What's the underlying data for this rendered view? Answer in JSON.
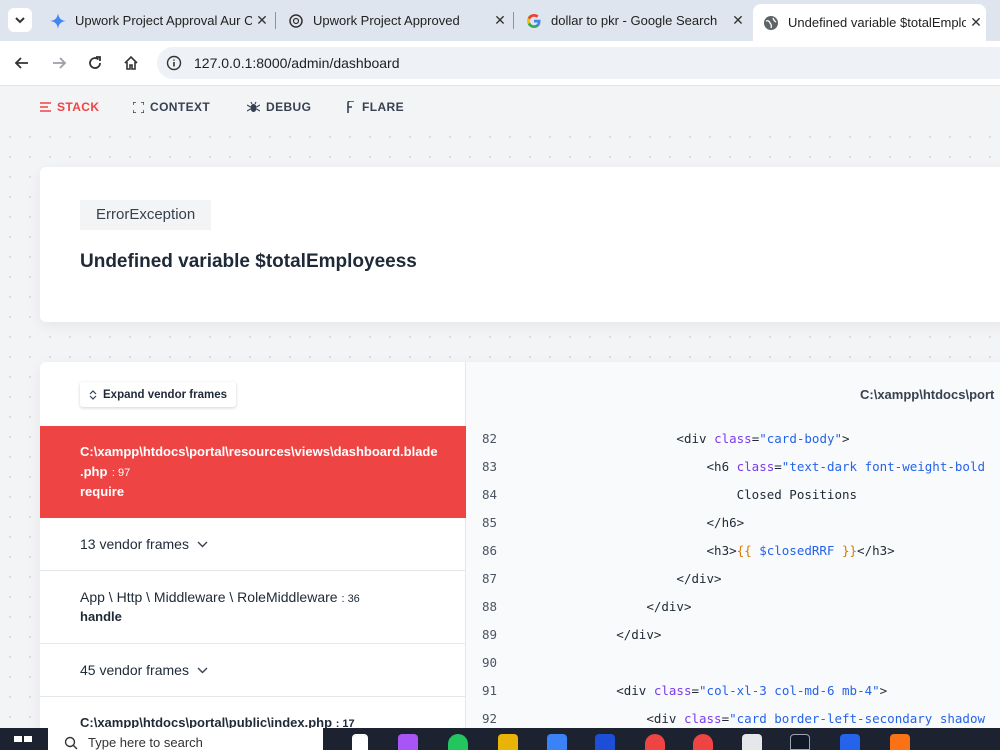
{
  "browser": {
    "tabs": [
      {
        "title": "Upwork Project Approval Aur C",
        "favicon": "gemini-sparkle-icon",
        "active": false
      },
      {
        "title": "Upwork Project Approved",
        "favicon": "chatgpt-icon",
        "active": false
      },
      {
        "title": "dollar to pkr - Google Search",
        "favicon": "google-icon",
        "active": false
      },
      {
        "title": "Undefined variable $totalEmplo",
        "favicon": "globe-icon",
        "active": true
      }
    ],
    "url": "127.0.0.1:8000/admin/dashboard"
  },
  "ignition_nav": {
    "items": [
      {
        "label": "STACK",
        "icon": "stack-icon"
      },
      {
        "label": "CONTEXT",
        "icon": "context-icon"
      },
      {
        "label": "DEBUG",
        "icon": "bug-icon"
      },
      {
        "label": "FLARE",
        "icon": "flare-icon"
      }
    ]
  },
  "error": {
    "exception": "ErrorException",
    "message": "Undefined variable $totalEmployeess"
  },
  "stack": {
    "expand_label": "Expand vendor frames",
    "active_frame": {
      "path": "C:\\xampp\\htdocs\\portal\\resources\\views\\dashboard.blade",
      "path_end": ".php",
      "line": ": 97",
      "method": "require"
    },
    "vendor_frames_1": "13 vendor frames",
    "frame2": {
      "path": "App \\ Http \\ Middleware \\ RoleMiddleware",
      "line": ": 36",
      "method": "handle"
    },
    "vendor_frames_2": "45 vendor frames",
    "frame3": {
      "path": "C:\\xampp\\htdocs\\portal\\public\\index.php",
      "line": ": 17"
    }
  },
  "code": {
    "file_path": "C:\\xampp\\htdocs\\port",
    "lines": [
      {
        "n": "82",
        "indent": "                ",
        "parts": [
          [
            "tg",
            "<div "
          ],
          [
            "at",
            "class"
          ],
          [
            "tg",
            "="
          ],
          [
            "st",
            "\"card-body\""
          ],
          [
            "tg",
            ">"
          ]
        ]
      },
      {
        "n": "83",
        "indent": "                    ",
        "parts": [
          [
            "tg",
            "<h6 "
          ],
          [
            "at",
            "class"
          ],
          [
            "tg",
            "="
          ],
          [
            "st",
            "\"text-dark font-weight-bold"
          ]
        ]
      },
      {
        "n": "84",
        "indent": "                        ",
        "parts": [
          [
            "tg",
            "Closed Positions"
          ]
        ]
      },
      {
        "n": "85",
        "indent": "                    ",
        "parts": [
          [
            "tg",
            "</h6>"
          ]
        ]
      },
      {
        "n": "86",
        "indent": "                    ",
        "parts": [
          [
            "tg",
            "<h3>"
          ],
          [
            "bl",
            "{{ "
          ],
          [
            "vr",
            "$closedRRF"
          ],
          [
            "bl",
            " }}"
          ],
          [
            "tg",
            "</h3>"
          ]
        ]
      },
      {
        "n": "87",
        "indent": "                ",
        "parts": [
          [
            "tg",
            "</div>"
          ]
        ]
      },
      {
        "n": "88",
        "indent": "            ",
        "parts": [
          [
            "tg",
            "</div>"
          ]
        ]
      },
      {
        "n": "89",
        "indent": "        ",
        "parts": [
          [
            "tg",
            "</div>"
          ]
        ]
      },
      {
        "n": "90",
        "indent": "",
        "parts": []
      },
      {
        "n": "91",
        "indent": "        ",
        "parts": [
          [
            "tg",
            "<div "
          ],
          [
            "at",
            "class"
          ],
          [
            "tg",
            "="
          ],
          [
            "st",
            "\"col-xl-3 col-md-6 mb-4\""
          ],
          [
            "tg",
            ">"
          ]
        ]
      },
      {
        "n": "92",
        "indent": "            ",
        "parts": [
          [
            "tg",
            "<div "
          ],
          [
            "at",
            "class"
          ],
          [
            "tg",
            "="
          ],
          [
            "st",
            "\"card border-left-secondary shadow"
          ]
        ]
      }
    ]
  },
  "taskbar": {
    "search_placeholder": "Type here to search"
  }
}
